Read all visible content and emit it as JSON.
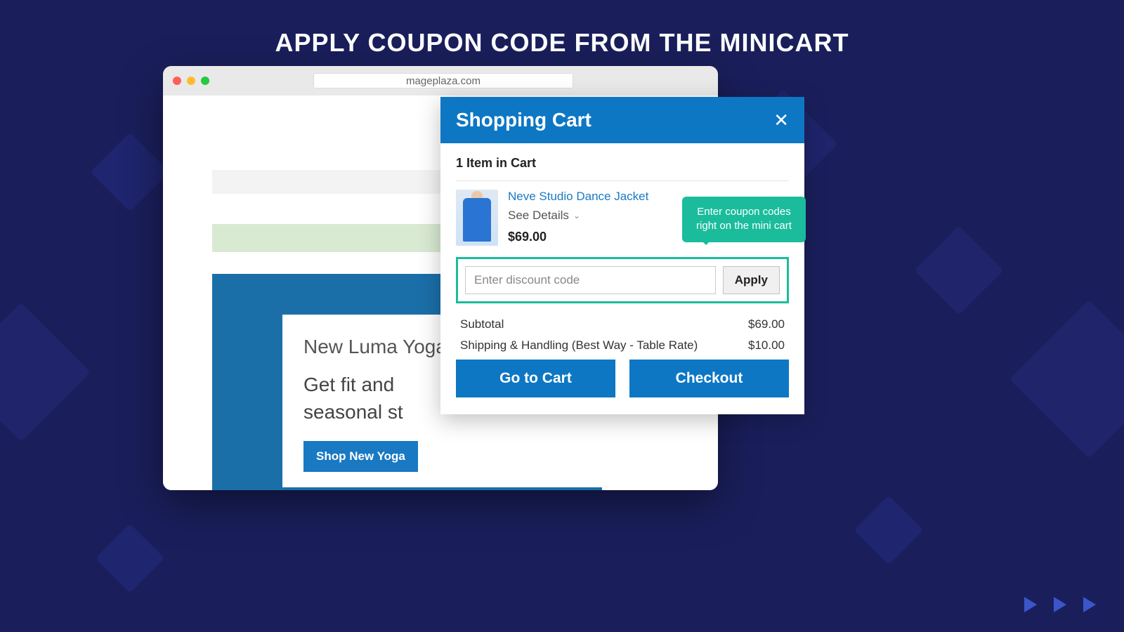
{
  "page_heading": "APPLY COUPON CODE FROM THE MINICART",
  "browser": {
    "url": "mageplaza.com"
  },
  "hero": {
    "title": "New Luma Yoga",
    "text_line_1": "Get fit and",
    "text_line_2": "seasonal st",
    "cta": "Shop New Yoga"
  },
  "minicart": {
    "title": "Shopping Cart",
    "item_count_label": "1 Item in Cart",
    "product": {
      "name": "Neve Studio Dance Jacket",
      "details_label": "See Details",
      "price": "$69.00"
    },
    "coupon": {
      "placeholder": "Enter discount code",
      "apply_label": "Apply"
    },
    "totals": {
      "subtotal_label": "Subtotal",
      "subtotal_value": "$69.00",
      "shipping_label": "Shipping & Handling (Best Way - Table Rate)",
      "shipping_value": "$10.00"
    },
    "go_to_cart_label": "Go to Cart",
    "checkout_label": "Checkout"
  },
  "tooltip": "Enter coupon codes right on the mini cart"
}
